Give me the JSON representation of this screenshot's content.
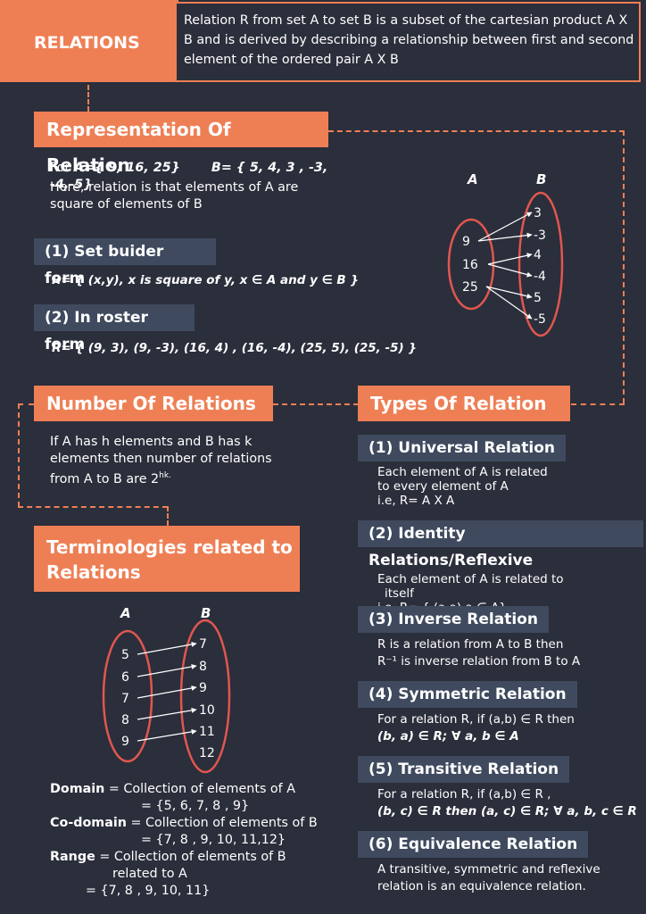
{
  "header": {
    "title": "RELATIONS",
    "description": "Relation R from set A  to set B is a subset of the cartesian product A X B and is derived by describing a relationship between first and second element of the ordered pair A X B"
  },
  "representation": {
    "title": "Representation Of Relation",
    "line1_prefix": "For",
    "set_a": "A={ 9, 16, 25}",
    "set_b": "B= { 5, 4, 3 , -3, -4,-5}",
    "line2": "Here, relation is that elements of A are square of elements of B",
    "setbuilder_title": "(1) Set buider form",
    "setbuilder_formula": "R= { (x,y), x is square of y, x ∈ A and y ∈ B }",
    "roster_title": "(2) In roster form",
    "roster_formula": "R= { (9, 3), (9, -3), (16, 4) , (16, -4), (25, 5), (25, -5) }",
    "diagram": {
      "label_a": "A",
      "label_b": "B",
      "a_items": [
        "9",
        "16",
        "25"
      ],
      "b_items": [
        "3",
        "-3",
        "4",
        "-4",
        "5",
        "-5"
      ]
    }
  },
  "number": {
    "title": "Number Of Relations",
    "text": "If A has h elements and B has k elements then number of relations from A to B are 2",
    "sup": "hk."
  },
  "terminologies": {
    "title_line1": "Terminologies related to",
    "title_line2": "Relations",
    "diagram": {
      "label_a": "A",
      "label_b": "B",
      "a_items": [
        "5",
        "6",
        "7",
        "8",
        "9"
      ],
      "b_items": [
        "7",
        "8",
        "9",
        "10",
        "11",
        "12"
      ]
    },
    "domain_label": "Domain",
    "domain_text": "= Collection of  elements of A",
    "domain_set": "= {5, 6, 7, 8 , 9}",
    "codomain_label": "Co-domain",
    "codomain_text": "= Collection of elements of B",
    "codomain_set": "= {7, 8 , 9, 10, 11,12}",
    "range_label": "Range",
    "range_text": "= Collection of elements of B",
    "range_text2": "related to A",
    "range_set": "= {7, 8 , 9, 10, 11}"
  },
  "types": {
    "title": "Types Of Relation",
    "items": [
      {
        "title": "(1) Universal Relation",
        "line1": "Each element of A is related",
        "line2": "to every element of A",
        "line3": "i.e, R= A X A"
      },
      {
        "title": "(2) Identity Relations/Reflexive",
        "line1": "Each element of A is related to",
        "line2": "itself",
        "line3": "i.e, R= { (a,a) a ∈ A}"
      },
      {
        "title": "(3) Inverse Relation",
        "line1": "R is a relation from A to B then",
        "line2": "R⁻¹ is inverse relation from B to A"
      },
      {
        "title": "(4) Symmetric Relation",
        "line1": "For a relation R, if (a,b)  ∈ R then",
        "line2": "(b, a) ∈ R; ∀ a, b ∈ A"
      },
      {
        "title": "(5) Transitive Relation",
        "line1": "For a relation R, if (a,b)  ∈ R ,",
        "line2": "(b, c) ∈ R  then (a, c) ∈ R; ∀ a, b, c ∈ R"
      },
      {
        "title": "(6) Equivalence Relation",
        "line1": "A transitive, symmetric and reflexive",
        "line2": "relation is an equivalence relation."
      }
    ]
  }
}
